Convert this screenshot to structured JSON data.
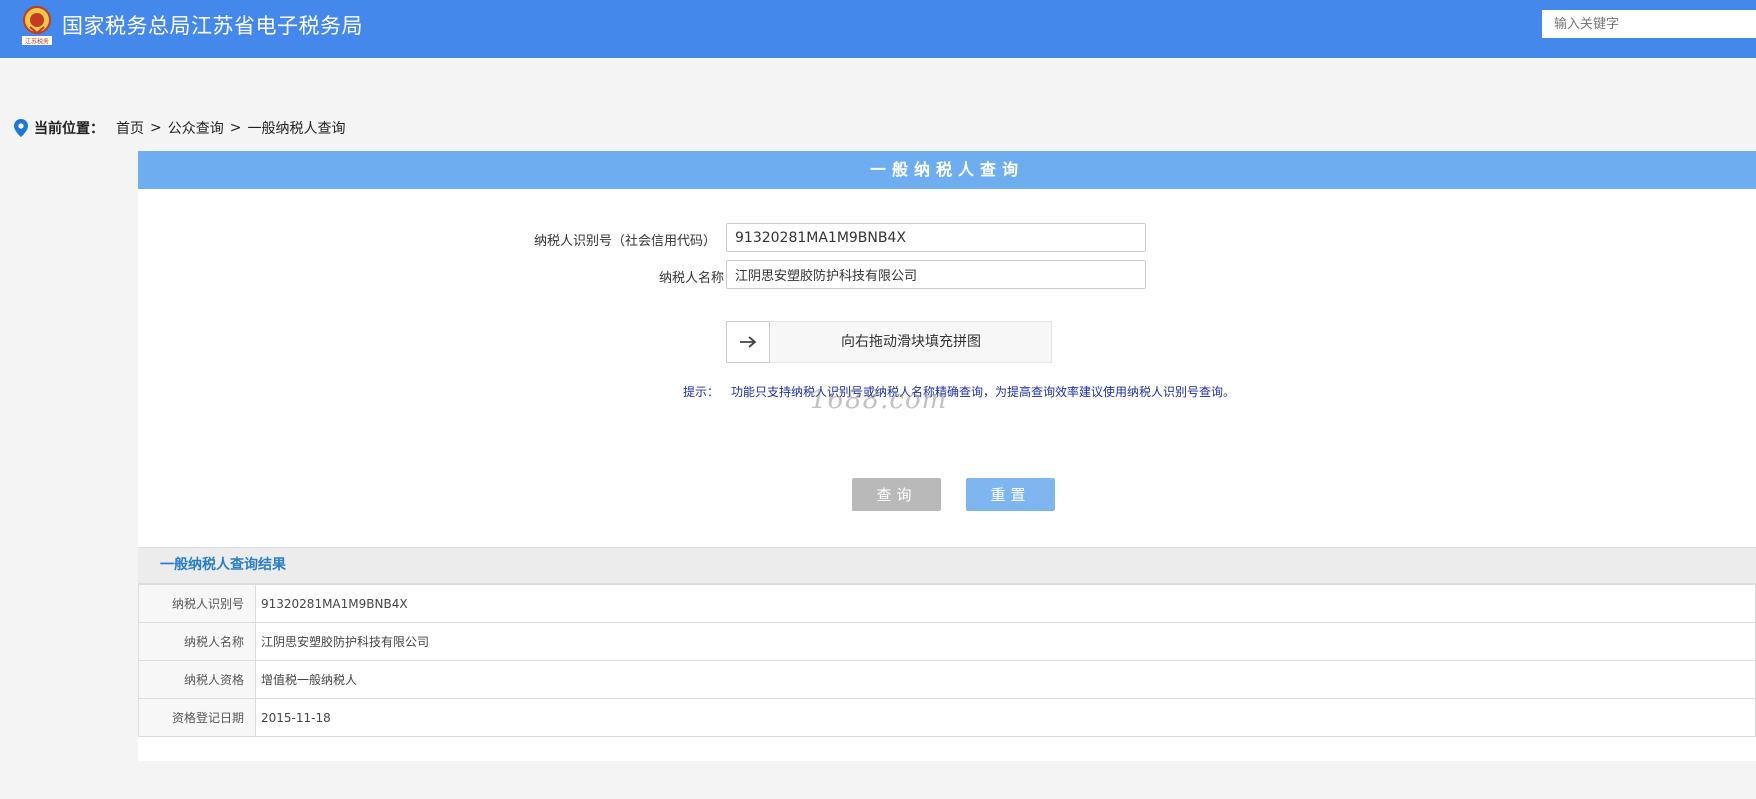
{
  "header": {
    "logo_text": "江苏税务",
    "title": "国家税务总局江苏省电子税务局",
    "search_placeholder": "输入关键字"
  },
  "breadcrumb": {
    "label": "当前位置：",
    "items": [
      "首页",
      "公众查询",
      "一般纳税人查询"
    ],
    "separator": ">"
  },
  "panel": {
    "title": "一般纳税人查询"
  },
  "form": {
    "tax_id_label": "纳税人识别号（社会信用代码）",
    "tax_id_value": "91320281MA1M9BNB4X",
    "name_label": "纳税人名称",
    "name_value": "江阴思安塑胶防护科技有限公司",
    "slider_text": "向右拖动滑块填充拼图",
    "tip_label": "提示：",
    "tip_text": "功能只支持纳税人识别号或纳税人名称精确查询，为提高查询效率建议使用纳税人识别号查询。",
    "watermark": "1688.com",
    "query_button": "查询",
    "reset_button": "重置"
  },
  "result": {
    "title": "一般纳税人查询结果",
    "rows": [
      {
        "key": "纳税人识别号",
        "value": "91320281MA1M9BNB4X"
      },
      {
        "key": "纳税人名称",
        "value": "江阴思安塑胶防护科技有限公司"
      },
      {
        "key": "纳税人资格",
        "value": "增值税一般纳税人"
      },
      {
        "key": "资格登记日期",
        "value": "2015-11-18"
      }
    ]
  },
  "colors": {
    "header_bg": "#4588ec",
    "panel_head_bg": "#6eaef0",
    "tip_text": "#1d2fa8",
    "result_title": "#2a7fc9"
  }
}
